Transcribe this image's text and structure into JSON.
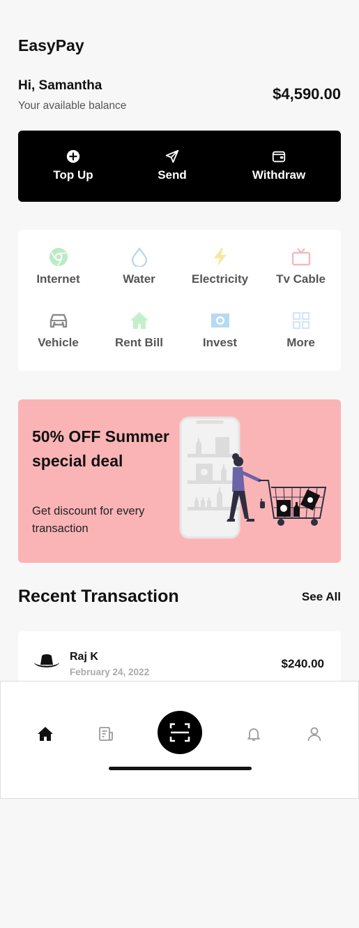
{
  "app": {
    "title": "EasyPay"
  },
  "greeting": {
    "text": "Hi, Samantha",
    "balance_label": "Your available balance",
    "balance": "$4,590.00"
  },
  "actions": [
    {
      "label": "Top Up",
      "icon": "plus-circle-icon"
    },
    {
      "label": "Send",
      "icon": "send-icon"
    },
    {
      "label": "Withdraw",
      "icon": "wallet-icon"
    }
  ],
  "services": [
    {
      "label": "Internet",
      "icon": "globe-icon",
      "color": "#b9ebc5"
    },
    {
      "label": "Water",
      "icon": "water-drop-icon",
      "color": "#b8d9f0"
    },
    {
      "label": "Electricity",
      "icon": "lightning-icon",
      "color": "#f8e7a0"
    },
    {
      "label": "Tv Cable",
      "icon": "tv-icon",
      "color": "#f4b8bf"
    },
    {
      "label": "Vehicle",
      "icon": "car-icon",
      "color": "#8a8a8a"
    },
    {
      "label": "Rent Bill",
      "icon": "house-icon",
      "color": "#c4f0c9"
    },
    {
      "label": "Invest",
      "icon": "money-icon",
      "color": "#b7daf2"
    },
    {
      "label": "More",
      "icon": "grid-icon",
      "color": "#d5e4f5"
    }
  ],
  "promo": {
    "title": "50% OFF Summer special deal",
    "subtitle": "Get discount for every transaction",
    "background": "#fbb4b6"
  },
  "recent": {
    "title": "Recent Transaction",
    "see_all": "See All",
    "items": [
      {
        "name": "Raj K",
        "date": "February 24, 2022",
        "amount": "$240.00",
        "avatar": "cowboy-hat-icon"
      }
    ]
  },
  "nav": {
    "items": [
      "home-icon",
      "receipt-icon",
      "scan-icon",
      "bell-icon",
      "user-icon"
    ],
    "active": "home-icon"
  }
}
